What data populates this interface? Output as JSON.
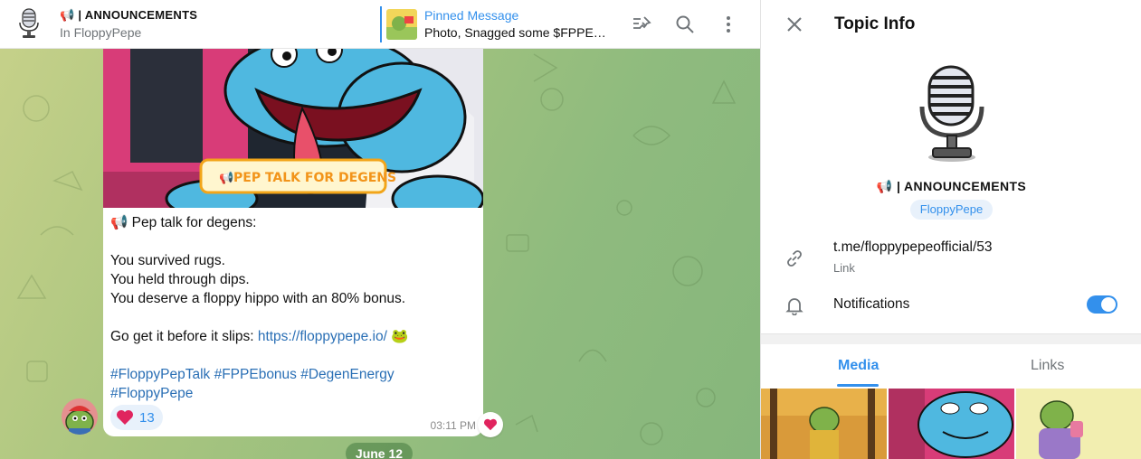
{
  "header": {
    "title": "📢 | ANNOUNCEMENTS",
    "subtitle": "In FloppyPepe",
    "pinned_title": "Pinned Message",
    "pinned_text": "Photo, Snagged some $FPPE? …"
  },
  "message": {
    "image_banner": "PEP TALK FOR DEGENS",
    "lines": [
      "📢 Pep talk for degens:",
      "",
      "You survived rugs.",
      "You held through dips.",
      "You deserve a floppy hippo with an 80% bonus.",
      ""
    ],
    "cta_prefix": "Go get it before it slips: ",
    "cta_link": "https://floppypepe.io/",
    "cta_suffix": " 🐸",
    "hashtags_line1": "#FloppyPepTalk #FPPEbonus #DegenEnergy",
    "hashtags_line2": "#FloppyPepe",
    "reaction_count": "13",
    "time": "03:11 PM"
  },
  "date_separator": "June 12",
  "panel": {
    "title": "Topic Info",
    "topic_name": "📢 | ANNOUNCEMENTS",
    "group_name": "FloppyPepe",
    "link_value": "t.me/floppypepeofficial/53",
    "link_label": "Link",
    "notifications_label": "Notifications",
    "notifications_on": true,
    "tabs": [
      "Media",
      "Links"
    ],
    "active_tab": "Media"
  },
  "colors": {
    "accent": "#3390ec",
    "heart": "#e0245e",
    "pepe_blue": "#4fb8e0",
    "pepe_green": "#7fb24a"
  }
}
